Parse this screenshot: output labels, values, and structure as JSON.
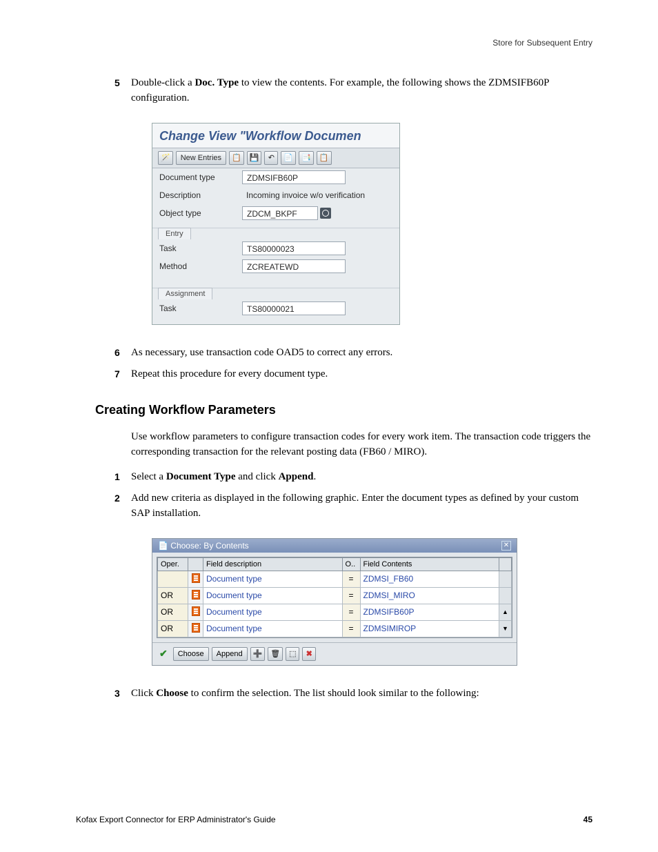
{
  "header": {
    "right": "Store for Subsequent Entry"
  },
  "steps_a": {
    "5": {
      "num": "5",
      "text_before": "Double-click a ",
      "bold1": "Doc. Type",
      "text_after": " to view the contents. For example, the following shows the ZDMSIFB60P configuration."
    },
    "6": {
      "num": "6",
      "text": "As necessary, use transaction code OAD5 to correct any errors."
    },
    "7": {
      "num": "7",
      "text": "Repeat this procedure for every document type."
    }
  },
  "fig1": {
    "title": "Change View \"Workflow Documen",
    "new_entries": "New Entries",
    "rows": {
      "doc_type": {
        "lbl": "Document type",
        "val": "ZDMSIFB60P"
      },
      "description": {
        "lbl": "Description",
        "val": "Incoming invoice w/o verification"
      },
      "object_type": {
        "lbl": "Object type",
        "val": "ZDCM_BKPF"
      }
    },
    "entry": {
      "tab": "Entry",
      "task": {
        "lbl": "Task",
        "val": "TS80000023"
      },
      "method": {
        "lbl": "Method",
        "val": "ZCREATEWD"
      }
    },
    "assignment": {
      "tab": "Assignment",
      "task": {
        "lbl": "Task",
        "val": "TS80000021"
      }
    }
  },
  "section_heading": "Creating Workflow Parameters",
  "section_intro": "Use workflow parameters to configure transaction codes for every work item. The transaction code triggers the corresponding transaction for the relevant posting data (FB60 / MIRO).",
  "steps_b": {
    "1": {
      "num": "1",
      "pre": "Select a ",
      "b1": "Document Type",
      "mid": " and click ",
      "b2": "Append",
      "post": "."
    },
    "2": {
      "num": "2",
      "text": "Add new criteria as displayed in the following graphic. Enter the document types as defined by your custom SAP installation."
    },
    "3": {
      "num": "3",
      "pre": "Click ",
      "b1": "Choose",
      "post": " to confirm the selection. The list should look similar to the following:"
    }
  },
  "fig2": {
    "title": "Choose: By Contents",
    "headers": {
      "oper": "Oper.",
      "fdesc": "Field description",
      "o": "O..",
      "fcont": "Field Contents"
    },
    "rows": [
      {
        "oper": "",
        "fdesc": "Document type",
        "eq": "=",
        "fcont": "ZDMSI_FB60"
      },
      {
        "oper": "OR",
        "fdesc": "Document type",
        "eq": "=",
        "fcont": "ZDMSI_MIRO"
      },
      {
        "oper": "OR",
        "fdesc": "Document type",
        "eq": "=",
        "fcont": "ZDMSIFB60P"
      },
      {
        "oper": "OR",
        "fdesc": "Document type",
        "eq": "=",
        "fcont": "ZDMSIMIROP"
      }
    ],
    "buttons": {
      "choose": "Choose",
      "append": "Append"
    }
  },
  "footer": {
    "left": "Kofax Export Connector for ERP Administrator's Guide",
    "page": "45"
  }
}
